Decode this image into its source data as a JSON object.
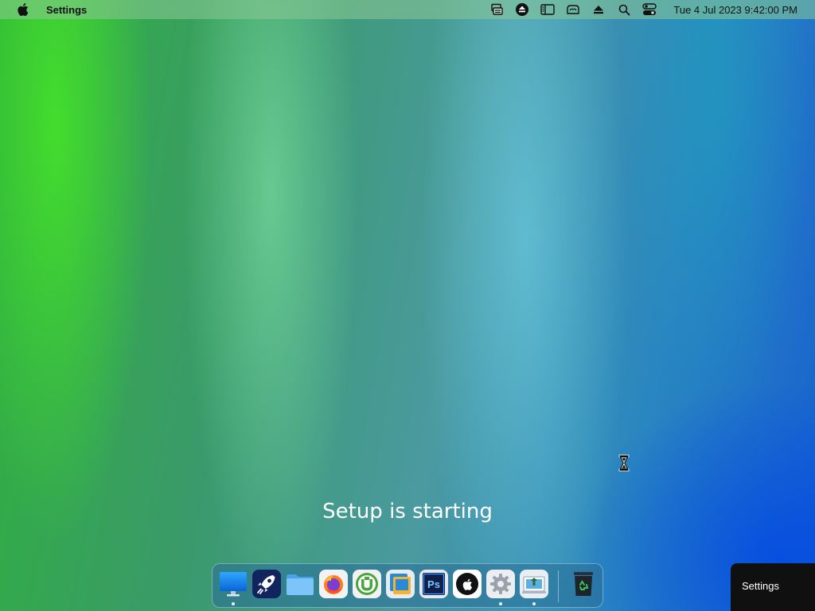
{
  "menubar": {
    "app_name": "Settings",
    "clock": "Tue 4 Jul 2023 9:42:00 PM",
    "tray_icons": [
      "display-sync-icon",
      "eject-circle-icon",
      "sidebar-icon",
      "cloud-drive-icon",
      "eject-icon",
      "search-icon",
      "control-center-icon"
    ]
  },
  "setup": {
    "message": "Setup is starting"
  },
  "dock": {
    "apps": [
      {
        "icon": "desktop-monitor-icon",
        "running": true
      },
      {
        "icon": "launchpad-rocket-icon",
        "running": false
      },
      {
        "icon": "folder-icon",
        "running": false
      },
      {
        "icon": "firefox-icon",
        "running": false
      },
      {
        "icon": "utorrent-icon",
        "running": false
      },
      {
        "icon": "virtual-machine-icon",
        "running": false
      },
      {
        "icon": "photoshop-icon",
        "running": false
      },
      {
        "icon": "apple-logo-icon",
        "running": false
      },
      {
        "icon": "settings-gear-icon",
        "running": true
      },
      {
        "icon": "installer-icon",
        "running": true
      }
    ],
    "trash_icon": "recycle-bin-icon",
    "photoshop_label": "Ps"
  },
  "popup": {
    "label": "Settings"
  },
  "colors": {
    "dock_background": "#2a6e96",
    "popup_background": "#101010",
    "text_white": "#ffffff"
  }
}
